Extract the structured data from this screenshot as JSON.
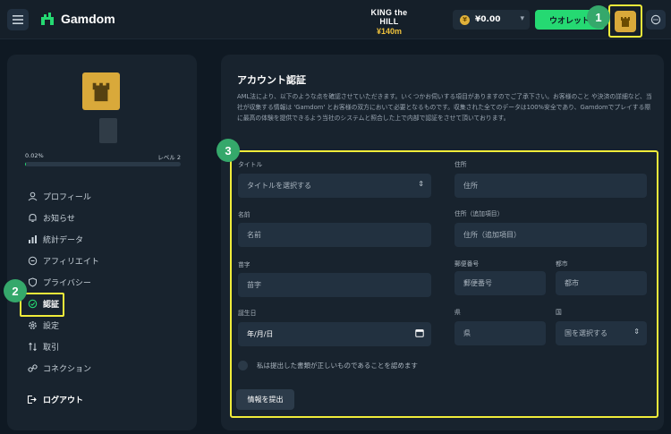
{
  "header": {
    "brand": "Gamdom",
    "promo_title": "KING the HILL",
    "promo_amount": "¥140m",
    "balance": "¥0.00",
    "wallet_label": "ウオレット"
  },
  "badges": {
    "one": "1",
    "two": "2",
    "three": "3"
  },
  "sidebar": {
    "progress_percent": "0.02%",
    "progress_fraction": 0.0002,
    "level_label": "レベル 2",
    "items": [
      {
        "label": "プロフィール",
        "icon": "user-icon"
      },
      {
        "label": "お知らせ",
        "icon": "bell-icon"
      },
      {
        "label": "統計データ",
        "icon": "stats-icon"
      },
      {
        "label": "アフィリエイト",
        "icon": "affiliate-icon"
      },
      {
        "label": "プライバシー",
        "icon": "privacy-icon"
      },
      {
        "label": "認証",
        "icon": "verify-icon"
      },
      {
        "label": "設定",
        "icon": "gear-icon"
      },
      {
        "label": "取引",
        "icon": "transactions-icon"
      },
      {
        "label": "コネクション",
        "icon": "link-icon"
      }
    ],
    "logout_label": "ログアウト"
  },
  "main": {
    "title": "アカウント認証",
    "description": "AML法により、以下のような点を確認させていただきます。いくつかお伺いする項目がありますのでご了承下さい。お客様のこと や決済の詳細など、当社が収集する情報は 'Gamdom' とお客様の双方において必要となるものです。収集された全てのデータは100%安全であり、Gamdomでプレイする際に最高の体験を提供できるよう当社のシステムと照合した上で内部で認証をさせて頂いております。",
    "form": {
      "title_label": "タイトル",
      "title_placeholder": "タイトルを選択する",
      "address_label": "住所",
      "address_placeholder": "住所",
      "first_name_label": "名前",
      "first_name_placeholder": "名前",
      "address2_label": "住所（追加項目）",
      "address2_placeholder": "住所（追加項目）",
      "last_name_label": "苗字",
      "last_name_placeholder": "苗字",
      "postal_label": "郵便番号",
      "postal_placeholder": "郵便番号",
      "city_label": "都市",
      "city_placeholder": "都市",
      "dob_label": "誕生日",
      "dob_placeholder": "年/月/日",
      "prefecture_label": "県",
      "prefecture_placeholder": "県",
      "country_label": "国",
      "country_placeholder": "国を選択する",
      "confirm_label": "私は提出した書類が正しいものであることを認めます",
      "submit_label": "情報を提出"
    }
  },
  "colors": {
    "background": "#0f1923",
    "panel": "#18232e",
    "accent_green": "#25d972",
    "highlight_yellow": "#f0ec3a",
    "gold": "#d9a93a"
  }
}
